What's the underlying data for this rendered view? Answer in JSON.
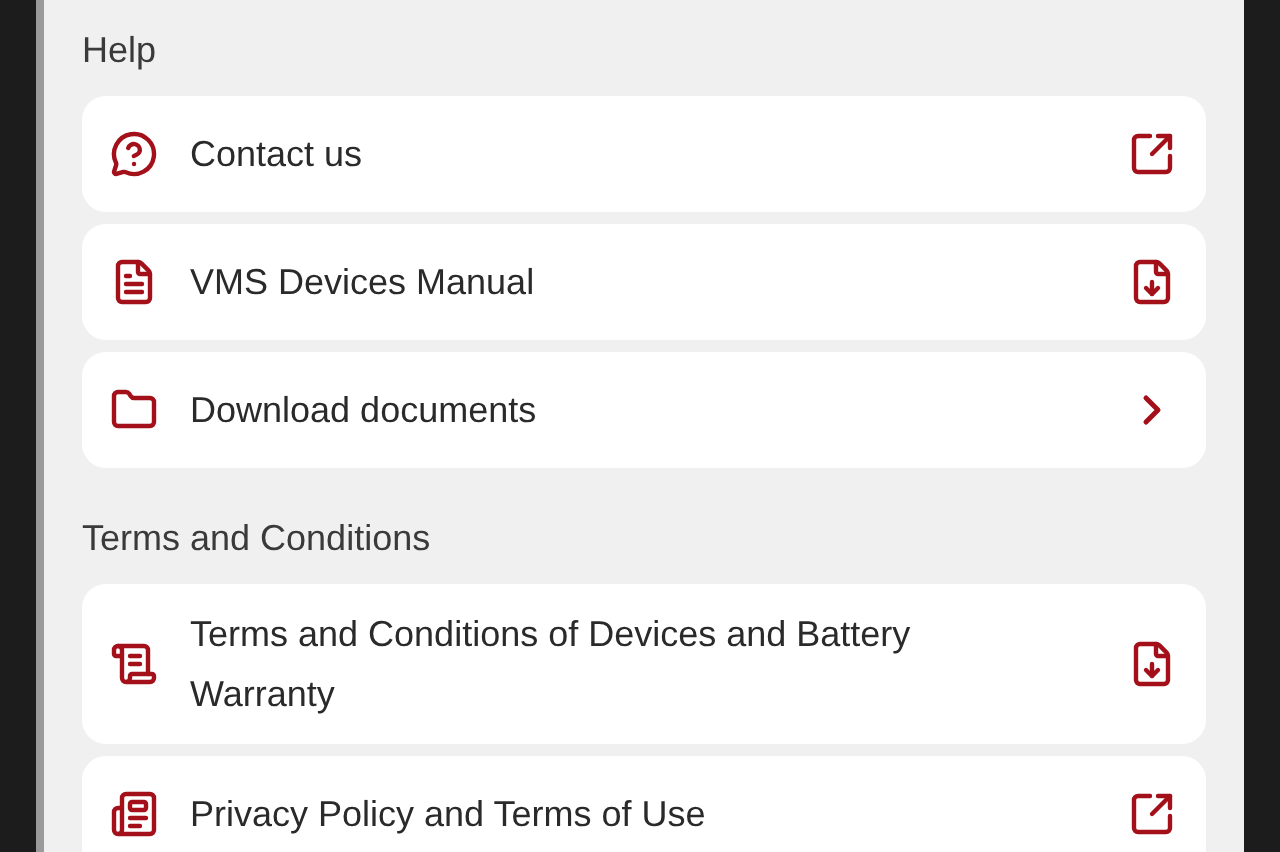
{
  "sections": [
    {
      "title": "Help",
      "items": [
        {
          "label": "Contact us",
          "kind": "external"
        },
        {
          "label": "VMS Devices Manual",
          "kind": "download"
        },
        {
          "label": "Download documents",
          "kind": "navigate"
        }
      ]
    },
    {
      "title": "Terms and Conditions",
      "items": [
        {
          "label": "Terms and Conditions of Devices and Battery Warranty",
          "kind": "download"
        },
        {
          "label": "Privacy Policy and Terms of Use",
          "kind": "external"
        }
      ]
    }
  ]
}
